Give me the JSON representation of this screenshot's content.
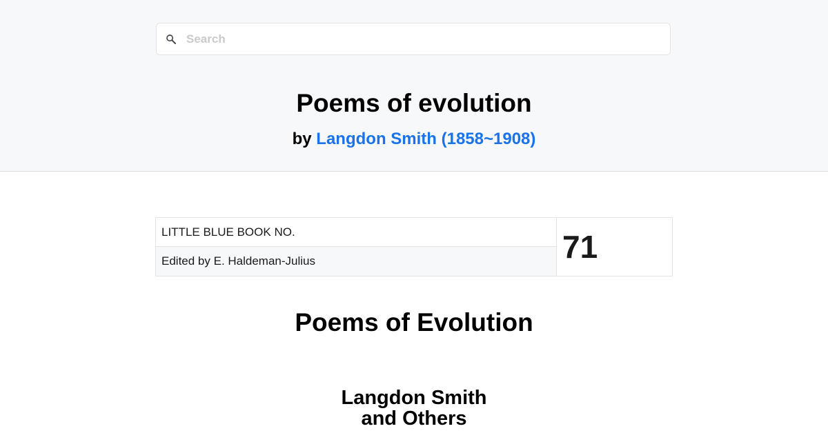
{
  "search": {
    "placeholder": "Search",
    "icon": "search-icon"
  },
  "header": {
    "title": "Poems of evolution",
    "by_prefix": "by",
    "author_link": "Langdon Smith (1858~1908)"
  },
  "info_table": {
    "series": "LITTLE BLUE BOOK NO.",
    "editor": "Edited by E. Haldeman-Julius",
    "number": "71"
  },
  "content": {
    "title": "Poems of Evolution",
    "author_line1": "Langdon Smith",
    "author_line2": "and Others"
  },
  "colors": {
    "link": "#1a73e8",
    "header_background": "#f7f8fa"
  }
}
